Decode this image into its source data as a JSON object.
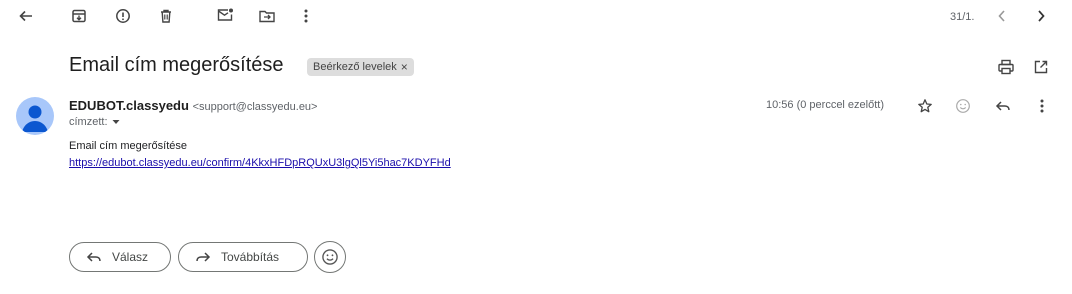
{
  "toolbar": {
    "back_icon": "arrow-left-icon",
    "archive_icon": "archive-icon",
    "spam_icon": "report-spam-icon",
    "delete_icon": "trash-icon",
    "mark_unread_icon": "mark-unread-icon",
    "move_icon": "move-to-icon",
    "more_icon": "more-vert-icon",
    "pager_text": "31/1.",
    "prev_icon": "chevron-left-icon",
    "next_icon": "chevron-right-icon"
  },
  "message": {
    "subject": "Email cím megerősítése",
    "label": "Beérkező levelek",
    "label_close": "×",
    "sender_name": "EDUBOT.classyedu",
    "sender_email": "<support@classyedu.eu>",
    "to_label": "címzett:",
    "time": "10:56 (0 perccel ezelőtt)",
    "body_line": "Email cím megerősítése",
    "link": "https://edubot.classyedu.eu/confirm/4KkxHFDpRQUxU3lgQl5Yi5hac7KDYFHd"
  },
  "actions": {
    "reply_label": "Válasz",
    "forward_label": "Továbbítás"
  },
  "colors": {
    "avatar_bg": "#a8c7fa",
    "avatar_fg": "#0b57d0",
    "link": "#1a0dab",
    "chip_bg": "#dddddd"
  }
}
